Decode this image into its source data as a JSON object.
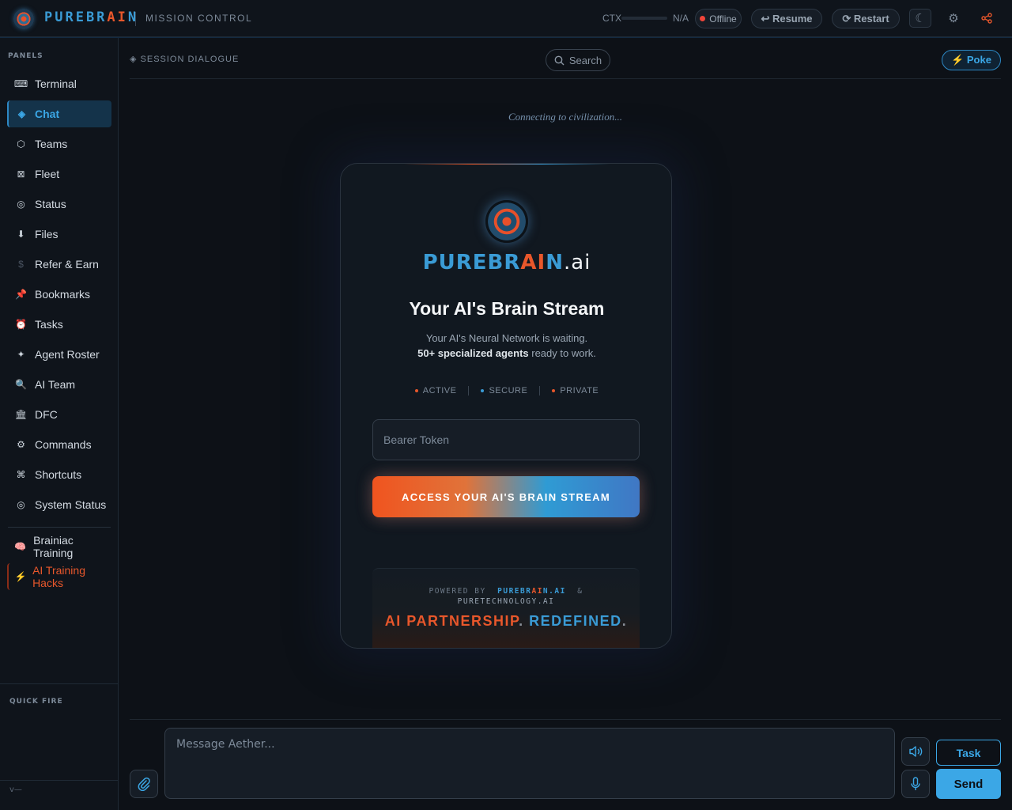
{
  "header": {
    "brand_main": "PUREBR",
    "brand_hot": "AI",
    "brand_end": "N",
    "subtitle": "MISSION CONTROL",
    "ctx_label": "CTX",
    "ctx_value": "N/A",
    "status": "Offline",
    "resume_label": "↩ Resume",
    "restart_label": "⟳ Restart",
    "moon_icon": "☾",
    "gear_icon": "⚙"
  },
  "sidebar": {
    "heading": "PANELS",
    "items": [
      {
        "icon": "⌨",
        "label": "Terminal"
      },
      {
        "icon": "◈",
        "label": "Chat"
      },
      {
        "icon": "⬡",
        "label": "Teams"
      },
      {
        "icon": "⊠",
        "label": "Fleet"
      },
      {
        "icon": "◎",
        "label": "Status"
      },
      {
        "icon": "⬇",
        "label": "Files"
      },
      {
        "icon": "$",
        "label": "Refer & Earn"
      },
      {
        "icon": "📌",
        "label": "Bookmarks"
      },
      {
        "icon": "⏰",
        "label": "Tasks"
      },
      {
        "icon": "✦",
        "label": "Agent Roster"
      },
      {
        "icon": "🔍",
        "label": "AI Team"
      },
      {
        "icon": "🏛",
        "label": "DFC"
      },
      {
        "icon": "⚙",
        "label": "Commands"
      },
      {
        "icon": "⌘",
        "label": "Shortcuts"
      },
      {
        "icon": "◎",
        "label": "System Status"
      },
      {
        "icon": "🧠",
        "label": "Brainiac Training"
      },
      {
        "icon": "⚡",
        "label": "AI Training Hacks"
      }
    ],
    "quick_fire": "QUICK FIRE",
    "version": "v—"
  },
  "main": {
    "session_label": "◈ SESSION DIALOGUE",
    "search_label": "Search",
    "poke_label": "⚡ Poke",
    "connecting": "Connecting to civilization..."
  },
  "login_card": {
    "brand_main": "PUREBR",
    "brand_hot": "AI",
    "brand_end": "N",
    "brand_suffix": ".ai",
    "title": "Your AI's Brain Stream",
    "sub_line1": "Your AI's Neural Network is waiting.",
    "sub_bold": "50+ specialized agents",
    "sub_line2_rest": " ready to work.",
    "badges": [
      {
        "label": "ACTIVE",
        "color": "#e8572b"
      },
      {
        "label": "SECURE",
        "color": "#3a9bd5"
      },
      {
        "label": "PRIVATE",
        "color": "#e8572b"
      }
    ],
    "token_placeholder": "Bearer Token",
    "access_button": "ACCESS YOUR AI'S BRAIN STREAM",
    "powered_by": "POWERED BY",
    "powered_brand_main": "PUREBR",
    "powered_brand_hot": "AI",
    "powered_brand_end": "N.AI",
    "powered_amp": "&",
    "powered_tech": "PURETECHNOLOGY.AI",
    "tagline_a": "AI PARTNERSHIP",
    "tagline_dot": ".",
    "tagline_b": "REDEFINED",
    "tagline_end": "."
  },
  "composer": {
    "placeholder": "Message Aether...",
    "task_label": "Task",
    "send_label": "Send"
  },
  "colors": {
    "accent_blue": "#3ba7e6",
    "accent_orange": "#e8572b",
    "status_red": "#f0453a",
    "background": "#0d1117"
  }
}
